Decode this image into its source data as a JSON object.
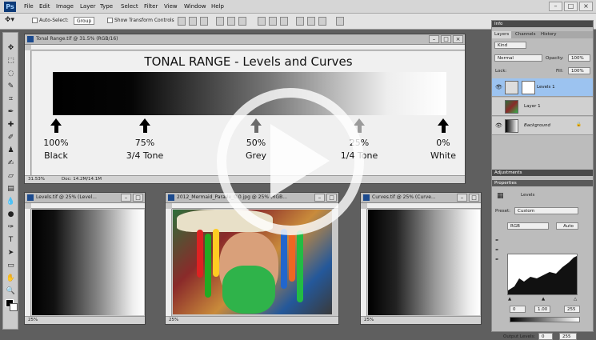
{
  "app": {
    "logo": "Ps"
  },
  "menu": [
    "File",
    "Edit",
    "Image",
    "Layer",
    "Type",
    "Select",
    "Filter",
    "View",
    "Window",
    "Help"
  ],
  "options_bar": {
    "auto_select_label": "Auto-Select:",
    "auto_select_value": "Group",
    "show_transform_label": "Show Transform Controls"
  },
  "main_doc": {
    "title": "Tonal Range.tif @ 31.5% (RGB/16)",
    "heading": "TONAL RANGE - Levels and Curves",
    "zoom": "31.53%",
    "doc_info": "Doc: 14.2M/14.1M",
    "tones": [
      {
        "pct": "100%",
        "name": "Black"
      },
      {
        "pct": "75%",
        "name": "3/4 Tone"
      },
      {
        "pct": "50%",
        "name": "Grey"
      },
      {
        "pct": "25%",
        "name": "1/4 Tone"
      },
      {
        "pct": "0%",
        "name": "White"
      }
    ]
  },
  "levels_doc": {
    "title": "Levels.tif @ 25% (Level...",
    "zoom": "25%"
  },
  "photo_doc": {
    "title": "2012_Mermaid_Parade_0.0.jpg @ 25% (RGB...",
    "zoom": "25%"
  },
  "curves_doc": {
    "title": "Curves.tif @ 25% (Curve...",
    "zoom": "25%"
  },
  "right_panel": {
    "info_tab": "Info",
    "tabs": [
      "Layers",
      "Channels",
      "History"
    ],
    "kind_label": "Kind",
    "blend_mode": "Normal",
    "opacity_label": "Opacity:",
    "opacity_value": "100%",
    "lock_label": "Lock:",
    "fill_label": "Fill:",
    "fill_value": "100%",
    "layers": [
      {
        "name": "Levels 1"
      },
      {
        "name": "Layer 1"
      },
      {
        "name": "Background"
      }
    ],
    "adjustments_label": "Adjustments",
    "properties_label": "Properties",
    "levels_label": "Levels",
    "preset_label": "Preset:",
    "preset_value": "Custom",
    "channel_value": "RGB",
    "auto_label": "Auto",
    "input_values": [
      "0",
      "1.00",
      "255"
    ],
    "output_label": "Output Levels:",
    "output_values": [
      "0",
      "255"
    ]
  },
  "colors": {
    "accent": "#9cc3f0",
    "beard": "#2fb34a",
    "dark_panel": "#4a4a4a"
  },
  "icons": [
    "move-tool-icon",
    "marquee-icon",
    "lasso-icon",
    "crop-icon",
    "eyedropper-icon",
    "brush-icon",
    "eraser-icon",
    "gradient-icon",
    "pen-icon",
    "type-icon",
    "hand-icon",
    "zoom-icon",
    "eye-icon",
    "play-icon"
  ]
}
